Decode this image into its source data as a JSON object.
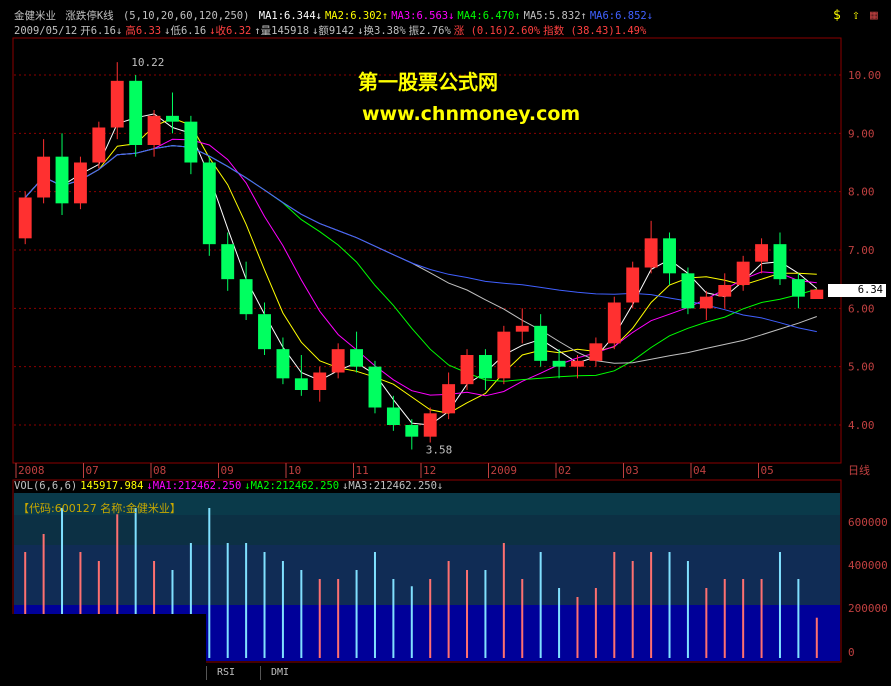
{
  "header": {
    "name": "金健米业",
    "indicator": "涨跌停K线",
    "ma_params": "(5,10,20,60,120,250)",
    "ma_values": [
      {
        "label": "MA1:6.344",
        "dir": "↓",
        "color": "#ffffff"
      },
      {
        "label": "MA2:6.302",
        "dir": "↑",
        "color": "#ffff00"
      },
      {
        "label": "MA3:6.563",
        "dir": "↓",
        "color": "#ff00ff"
      },
      {
        "label": "MA4:6.470",
        "dir": "↑",
        "color": "#00ff00"
      },
      {
        "label": "MA5:5.832",
        "dir": "↑",
        "color": "#c0c0c0"
      },
      {
        "label": "MA6:6.852",
        "dir": "↓",
        "color": "#4060ff"
      }
    ],
    "ohlc_row": [
      {
        "text": "2009/05/12",
        "color": "#c0c0c0"
      },
      {
        "text": "开6.16↓",
        "color": "#c0c0c0"
      },
      {
        "text": "高6.33",
        "color": "#ff4040"
      },
      {
        "text": "↓低6.16",
        "color": "#c0c0c0"
      },
      {
        "text": "↓收6.32",
        "color": "#ff4040"
      },
      {
        "text": "↑量145918",
        "color": "#c0c0c0"
      },
      {
        "text": "↓额9142",
        "color": "#c0c0c0"
      },
      {
        "text": "↓换3.38%",
        "color": "#c0c0c0"
      },
      {
        "text": "振2.76%",
        "color": "#c0c0c0"
      },
      {
        "text": "涨 (0.16)2.60%",
        "color": "#ff4040"
      },
      {
        "text": "指数 (38.43)1.49%",
        "color": "#ff4040"
      }
    ]
  },
  "watermark": {
    "line1": "第一股票公式网",
    "line2": "www.chnmoney.com"
  },
  "price_marker": "6.34",
  "period_label": "日线",
  "volume_header": [
    {
      "text": "VOL(6,6,6)",
      "color": "#c0c0c0"
    },
    {
      "text": "145917.984",
      "color": "#ffff00"
    },
    {
      "text": "↓MA1:212462.250",
      "color": "#ff00ff"
    },
    {
      "text": "↓MA2:212462.250",
      "color": "#00ff00"
    },
    {
      "text": "↓MA3:212462.250↓",
      "color": "#c0c0c0"
    }
  ],
  "code_box": "【代码:600127 名称:金健米业】",
  "tabs": [
    "RSI",
    "DMI"
  ],
  "colors": {
    "up": "#ff3030",
    "down": "#00ff60",
    "grid": "#8b0000",
    "axis": "#c04040"
  },
  "chart_data": {
    "type": "candlestick",
    "title": "",
    "y_ticks": [
      4.0,
      5.0,
      6.0,
      7.0,
      8.0,
      9.0,
      10.0
    ],
    "ylim": [
      3.4,
      10.6
    ],
    "x_labels": [
      "2008",
      "07",
      "08",
      "09",
      "10",
      "11",
      "12",
      "2009",
      "02",
      "03",
      "04",
      "05"
    ],
    "annotations": [
      {
        "text": "10.22",
        "price": 10.22
      },
      {
        "text": "3.58",
        "price": 3.58
      }
    ],
    "candles": [
      {
        "o": 7.2,
        "h": 8.0,
        "l": 7.1,
        "c": 7.9
      },
      {
        "o": 7.9,
        "h": 8.9,
        "l": 7.8,
        "c": 8.6
      },
      {
        "o": 8.6,
        "h": 9.0,
        "l": 7.6,
        "c": 7.8
      },
      {
        "o": 7.8,
        "h": 8.6,
        "l": 7.7,
        "c": 8.5
      },
      {
        "o": 8.5,
        "h": 9.2,
        "l": 8.4,
        "c": 9.1
      },
      {
        "o": 9.1,
        "h": 10.22,
        "l": 8.9,
        "c": 9.9
      },
      {
        "o": 9.9,
        "h": 10.0,
        "l": 8.6,
        "c": 8.8
      },
      {
        "o": 8.8,
        "h": 9.4,
        "l": 8.6,
        "c": 9.3
      },
      {
        "o": 9.3,
        "h": 9.7,
        "l": 9.0,
        "c": 9.2
      },
      {
        "o": 9.2,
        "h": 9.3,
        "l": 8.3,
        "c": 8.5
      },
      {
        "o": 8.5,
        "h": 8.6,
        "l": 6.9,
        "c": 7.1
      },
      {
        "o": 7.1,
        "h": 7.3,
        "l": 6.3,
        "c": 6.5
      },
      {
        "o": 6.5,
        "h": 6.8,
        "l": 5.8,
        "c": 5.9
      },
      {
        "o": 5.9,
        "h": 6.1,
        "l": 5.2,
        "c": 5.3
      },
      {
        "o": 5.3,
        "h": 5.5,
        "l": 4.7,
        "c": 4.8
      },
      {
        "o": 4.8,
        "h": 5.2,
        "l": 4.5,
        "c": 4.6
      },
      {
        "o": 4.6,
        "h": 5.0,
        "l": 4.4,
        "c": 4.9
      },
      {
        "o": 4.9,
        "h": 5.4,
        "l": 4.8,
        "c": 5.3
      },
      {
        "o": 5.3,
        "h": 5.6,
        "l": 4.9,
        "c": 5.0
      },
      {
        "o": 5.0,
        "h": 5.1,
        "l": 4.2,
        "c": 4.3
      },
      {
        "o": 4.3,
        "h": 4.5,
        "l": 3.9,
        "c": 4.0
      },
      {
        "o": 4.0,
        "h": 4.1,
        "l": 3.58,
        "c": 3.8
      },
      {
        "o": 3.8,
        "h": 4.3,
        "l": 3.7,
        "c": 4.2
      },
      {
        "o": 4.2,
        "h": 4.9,
        "l": 4.1,
        "c": 4.7
      },
      {
        "o": 4.7,
        "h": 5.3,
        "l": 4.6,
        "c": 5.2
      },
      {
        "o": 5.2,
        "h": 5.3,
        "l": 4.6,
        "c": 4.8
      },
      {
        "o": 4.8,
        "h": 5.7,
        "l": 4.7,
        "c": 5.6
      },
      {
        "o": 5.6,
        "h": 6.0,
        "l": 5.4,
        "c": 5.7
      },
      {
        "o": 5.7,
        "h": 5.9,
        "l": 5.0,
        "c": 5.1
      },
      {
        "o": 5.1,
        "h": 5.3,
        "l": 4.8,
        "c": 5.0
      },
      {
        "o": 5.0,
        "h": 5.2,
        "l": 4.8,
        "c": 5.1
      },
      {
        "o": 5.1,
        "h": 5.5,
        "l": 5.0,
        "c": 5.4
      },
      {
        "o": 5.4,
        "h": 6.2,
        "l": 5.3,
        "c": 6.1
      },
      {
        "o": 6.1,
        "h": 6.8,
        "l": 6.0,
        "c": 6.7
      },
      {
        "o": 6.7,
        "h": 7.5,
        "l": 6.6,
        "c": 7.2
      },
      {
        "o": 7.2,
        "h": 7.3,
        "l": 6.4,
        "c": 6.6
      },
      {
        "o": 6.6,
        "h": 6.7,
        "l": 5.9,
        "c": 6.0
      },
      {
        "o": 6.0,
        "h": 6.3,
        "l": 5.8,
        "c": 6.2
      },
      {
        "o": 6.2,
        "h": 6.6,
        "l": 6.0,
        "c": 6.4
      },
      {
        "o": 6.4,
        "h": 6.9,
        "l": 6.3,
        "c": 6.8
      },
      {
        "o": 6.8,
        "h": 7.2,
        "l": 6.6,
        "c": 7.1
      },
      {
        "o": 7.1,
        "h": 7.3,
        "l": 6.4,
        "c": 6.5
      },
      {
        "o": 6.5,
        "h": 6.6,
        "l": 6.0,
        "c": 6.2
      },
      {
        "o": 6.16,
        "h": 6.33,
        "l": 6.16,
        "c": 6.32
      }
    ]
  }
}
